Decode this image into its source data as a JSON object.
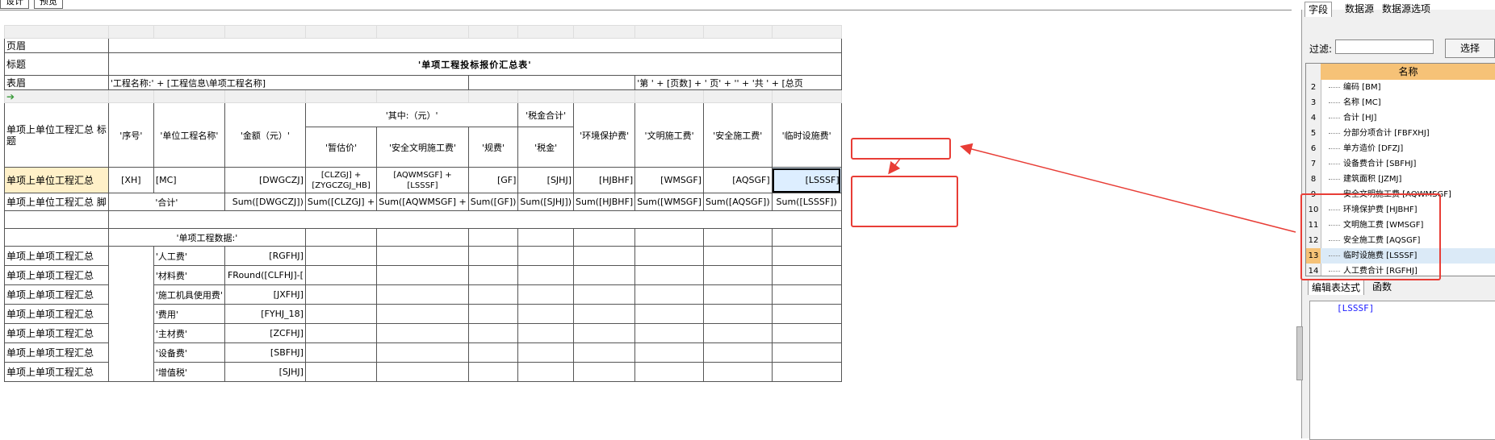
{
  "top_tabs": [
    "设计",
    "预览"
  ],
  "grid": {
    "col_header_cells": [
      "",
      "",
      "",
      "",
      "",
      "",
      "",
      "",
      "",
      "",
      ""
    ],
    "rows": {
      "yemei": "页眉",
      "biaoti": "标题",
      "title_text": "'单项工程投标报价汇总表'",
      "biaomei": "表眉",
      "project_name": "'工程名称:' + [工程信息\\单项工程名称]",
      "page_expr": "'第  ' + [页数] + ' 页' + '' + '共  ' + [总页",
      "arrow": "➔",
      "header_label": "单项上单位工程汇总 标题",
      "h_seq": "'序号'",
      "h_unit_name": "'单位工程名称'",
      "h_amount": "'金额（元）'",
      "h_qizhong": "'其中:（元）'",
      "h_tax_total": "'税金合计'",
      "h_env": "'环境保护费'",
      "h_civil": "'文明施工费'",
      "h_safety": "'安全施工费'",
      "h_temp": "'临时设施费'",
      "h_provisional": "'暂估价'",
      "h_safe_civil": "'安全文明施工费'",
      "h_fee": "'规费'",
      "h_tax": "'税金'",
      "body_label": "单项上单位工程汇总",
      "b_seq": "[XH]",
      "b_name": "[MC]",
      "b_amount": "[DWGCZJ]",
      "b_provisional": "[CLZGJ] + [ZYGCZGJ_HB]",
      "b_safe_civil": "[AQWMSGF] + [LSSSF]",
      "b_fee": "[GF]",
      "b_tax": "[SJHJ]",
      "b_env": "[HJBHF]",
      "b_civil": "[WMSGF]",
      "b_safety": "[AQSGF]",
      "b_temp": "[LSSSF]",
      "footer_label": "单项上单位工程汇总 脚",
      "f_total": "'合计'",
      "f_amount": "Sum([DWGCZJ])",
      "f_provisional": "Sum([CLZGJ] +",
      "f_safe_civil": "Sum([AQWMSGF] +",
      "f_fee": "Sum([GF])",
      "f_tax": "Sum([SJHJ])",
      "f_env": "Sum([HJBHF]",
      "f_civil": "Sum([WMSGF]",
      "f_safety": "Sum([AQSGF])",
      "f_temp": "Sum([LSSSF])",
      "data_title": "'单项工程数据:'",
      "item_label": "单项上单项工程汇总",
      "items": [
        {
          "name": "'人工费'",
          "expr": "[RGFHJ]"
        },
        {
          "name": "'材料费'",
          "expr": "FRound([CLFHJ]-["
        },
        {
          "name": "'施工机具使用费'",
          "expr": "[JXFHJ]"
        },
        {
          "name": "'费用'",
          "expr": "[FYHJ_18]"
        },
        {
          "name": "'主材费'",
          "expr": "[ZCFHJ]"
        },
        {
          "name": "'设备费'",
          "expr": "[SBFHJ]"
        },
        {
          "name": "'增值税'",
          "expr": "[SJHJ]"
        }
      ]
    }
  },
  "panel": {
    "tabs": [
      "字段",
      "数据源",
      "数据源选项"
    ],
    "filter_label": "过滤:",
    "filter_value": "",
    "select_button": "选择",
    "list_header": "名称",
    "fields": [
      {
        "num": "2",
        "text": "编码 [BM]"
      },
      {
        "num": "3",
        "text": "名称 [MC]"
      },
      {
        "num": "4",
        "text": "合计 [HJ]"
      },
      {
        "num": "5",
        "text": "分部分项合计 [FBFXHJ]"
      },
      {
        "num": "6",
        "text": "单方造价 [DFZJ]"
      },
      {
        "num": "7",
        "text": "设备费合计 [SBFHJ]"
      },
      {
        "num": "8",
        "text": "建筑面积 [JZMJ]"
      },
      {
        "num": "9",
        "text": "安全文明施工费 [AQWMSGF]"
      },
      {
        "num": "10",
        "text": "环境保护费 [HJBHF]"
      },
      {
        "num": "11",
        "text": "文明施工费 [WMSGF]"
      },
      {
        "num": "12",
        "text": "安全施工费 [AQSGF]"
      },
      {
        "num": "13",
        "text": "临时设施费 [LSSSF]"
      },
      {
        "num": "14",
        "text": "人工费合计 [RGFHJ]"
      }
    ],
    "expr_tabs": [
      "编辑表达式",
      "函数"
    ],
    "expr_value": "[LSSSF]"
  },
  "colors": {
    "annotation": "#e83d36",
    "selected_row": "#fff0c8",
    "header_orange": "#f6c277",
    "expr_blue": "#1a1aff"
  }
}
